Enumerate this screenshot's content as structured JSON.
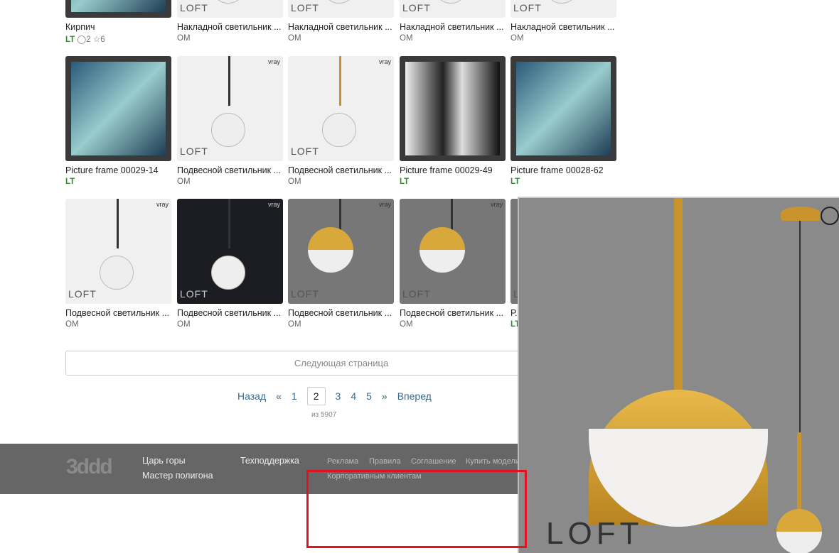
{
  "cards": [
    {
      "title": "Кирпич",
      "sub": "LT",
      "comments": "2",
      "stars": "6",
      "style": "art"
    },
    {
      "title": "Накладной светильник ...",
      "sub": "OM",
      "style": "light"
    },
    {
      "title": "Накладной светильник ...",
      "sub": "OM",
      "style": "light"
    },
    {
      "title": "Накладной светильник ...",
      "sub": "OM",
      "style": "light"
    },
    {
      "title": "Накладной светильник ...",
      "sub": "OM",
      "style": "light"
    },
    {
      "title": "Picture frame 00029-14",
      "sub": "LT",
      "style": "art"
    },
    {
      "title": "Подвесной светильник ...",
      "sub": "OM",
      "style": "light"
    },
    {
      "title": "Подвесной светильник ...",
      "sub": "OM",
      "style": "light-gold"
    },
    {
      "title": "Picture frame 00029-49",
      "sub": "LT",
      "style": "art-bw"
    },
    {
      "title": "Picture frame 00028-62",
      "sub": "LT",
      "style": "art"
    },
    {
      "title": "Подвесной светильник ...",
      "sub": "OM",
      "style": "light"
    },
    {
      "title": "Подвесной светильник ...",
      "sub": "OM",
      "style": "dark"
    },
    {
      "title": "Подвесной светильник ...",
      "sub": "OM",
      "style": "gray"
    },
    {
      "title": "Подвесной светильник ...",
      "sub": "OM",
      "style": "gray"
    },
    {
      "title": "Р...",
      "sub": "LT",
      "style": "gray"
    }
  ],
  "brand_mark": "LOFT",
  "vray": "vray",
  "next_page": "Следующая страница",
  "pagination": {
    "prev": "Назад",
    "first": "«",
    "pages": [
      "1",
      "2",
      "3",
      "4",
      "5"
    ],
    "current": "2",
    "last": "»",
    "next": "Вперед",
    "total": "из 5907"
  },
  "footer": {
    "logo": "3ddd",
    "links1": [
      "Царь горы",
      "Мастер полигона"
    ],
    "support": "Техподдержка",
    "links2": [
      "Реклама",
      "Правила",
      "Соглашение",
      "Купить модели"
    ],
    "corporate": "Корпоративным клиентам"
  },
  "overlay": {
    "brand": "LOFT"
  }
}
